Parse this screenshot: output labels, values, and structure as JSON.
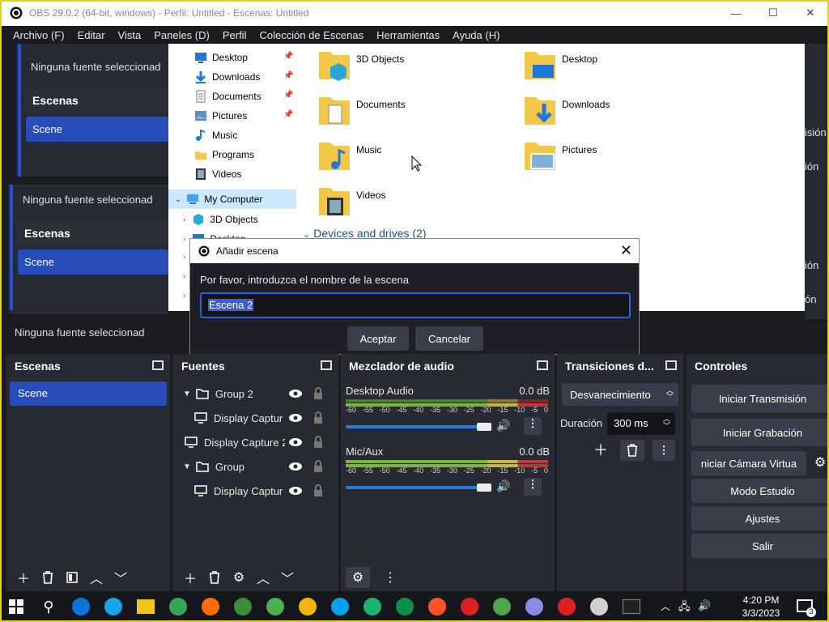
{
  "window": {
    "title": "OBS 29.0.2 (64-bit, windows) - Perfil: Untitled - Escenas: Untitled"
  },
  "menu": [
    "Archivo (F)",
    "Editar",
    "Vista",
    "Paneles (D)",
    "Perfil",
    "Colección de Escenas",
    "Herramientas",
    "Ayuda (H)"
  ],
  "background": {
    "no_source_1": "Ninguna fuente seleccionada",
    "no_source_2": "Ninguna fuente seleccionada",
    "no_source_3": "Ninguna fuente seleccionada",
    "scenes_head_1": "Escenas",
    "scenes_head_2": "Escenas",
    "scene_item_1": "Scene",
    "scene_item_2": "Scene",
    "right_frag_1": "isión",
    "right_frag_2": "ión",
    "right_frag_3": "ión",
    "right_frag_4": "ón"
  },
  "explorer": {
    "nav": [
      {
        "label": "Desktop",
        "icon": "desktop-icon",
        "pinned": true
      },
      {
        "label": "Downloads",
        "icon": "download-icon",
        "pinned": true
      },
      {
        "label": "Documents",
        "icon": "document-icon",
        "pinned": true
      },
      {
        "label": "Pictures",
        "icon": "picture-icon",
        "pinned": true
      },
      {
        "label": "Music",
        "icon": "music-icon",
        "pinned": false
      },
      {
        "label": "Programs",
        "icon": "folder-icon",
        "pinned": false
      },
      {
        "label": "Videos",
        "icon": "video-icon",
        "pinned": false
      }
    ],
    "my_computer": "My Computer",
    "sub_3d": "3D Objects",
    "sub_desktop": "Desktop",
    "folders": [
      {
        "label": "3D Objects",
        "icon": "3d-objects-icon"
      },
      {
        "label": "Desktop",
        "icon": "desktop-folder-icon"
      },
      {
        "label": "Documents",
        "icon": "documents-folder-icon"
      },
      {
        "label": "Downloads",
        "icon": "downloads-folder-icon"
      },
      {
        "label": "Music",
        "icon": "music-folder-icon"
      },
      {
        "label": "Pictures",
        "icon": "pictures-folder-icon"
      },
      {
        "label": "Videos",
        "icon": "videos-folder-icon"
      }
    ],
    "devices_heading": "Devices and drives (2)"
  },
  "dialog": {
    "title": "Añadir escena",
    "prompt": "Por favor, introduzca el nombre de la escena",
    "value": "Escena 2",
    "accept": "Aceptar",
    "cancel": "Cancelar"
  },
  "docks": {
    "scenes": {
      "title": "Escenas",
      "items": [
        "Scene"
      ]
    },
    "sources": {
      "title": "Fuentes",
      "items": [
        {
          "label": "Group 2",
          "type": "group"
        },
        {
          "label": "Display Captur",
          "type": "display"
        },
        {
          "label": "Display Capture 2",
          "type": "display"
        },
        {
          "label": "Group",
          "type": "group"
        },
        {
          "label": "Display Captur",
          "type": "display"
        }
      ]
    },
    "mixer": {
      "title": "Mezclador de audio",
      "channels": [
        {
          "name": "Desktop Audio",
          "db": "0.0 dB"
        },
        {
          "name": "Mic/Aux",
          "db": "0.0 dB"
        }
      ],
      "ticks": [
        "-60",
        "-55",
        "-50",
        "-45",
        "-40",
        "-35",
        "-30",
        "-25",
        "-20",
        "-15",
        "-10",
        "-5",
        "0"
      ]
    },
    "transitions": {
      "title": "Transiciones d...",
      "type": "Desvanecimiento",
      "duration_label": "Duración",
      "duration_value": "300 ms"
    },
    "controls": {
      "title": "Controles",
      "start_stream": "Iniciar Transmisión",
      "start_record": "Iniciar Grabación",
      "virtual_cam": "niciar Cámara Virtua",
      "studio_mode": "Modo Estudio",
      "settings": "Ajustes",
      "exit": "Salir"
    }
  },
  "taskbar": {
    "time": "4:20 PM",
    "date": "3/3/2023",
    "notifications": "3",
    "app_colors": [
      "#0a74da",
      "#1aa3e8",
      "#f0c419",
      "#34a853",
      "#ff6d00",
      "#3b8c3b",
      "#4caf50",
      "#f4b400",
      "#00a2ed",
      "#1db36f",
      "#0b8f4a",
      "#fb542b",
      "#e02020",
      "#4ca64c",
      "#8a8ae8",
      "#e02020",
      "#d0d0d0",
      "#222222"
    ]
  }
}
